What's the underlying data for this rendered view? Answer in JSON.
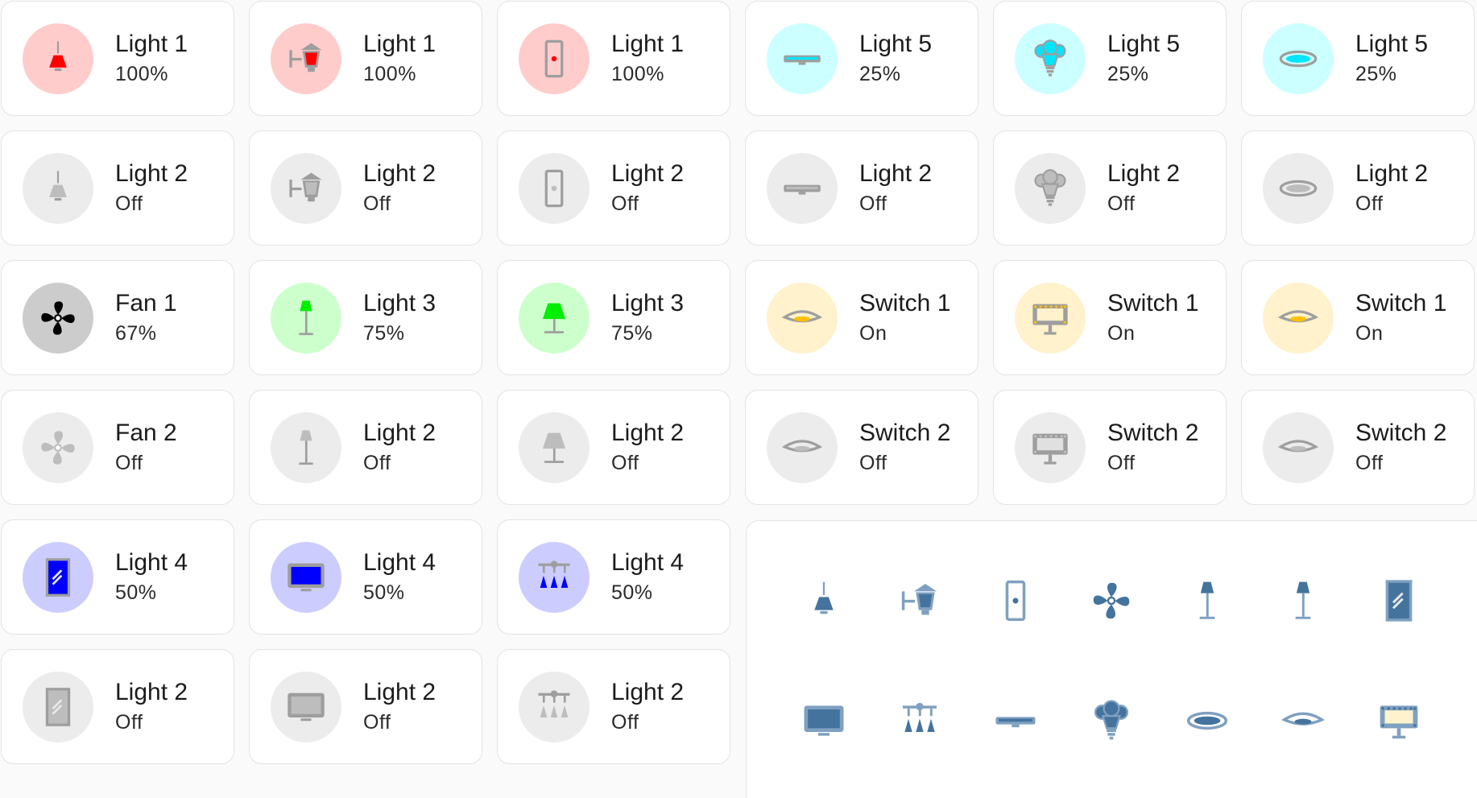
{
  "tiles": [
    {
      "name": "Light 1",
      "state": "100%",
      "icon": "hanging-lamp-icon",
      "bg": "#ffcccc",
      "fg": "#ff0000"
    },
    {
      "name": "Light 1",
      "state": "100%",
      "icon": "wall-lantern-icon",
      "bg": "#ffcccc",
      "fg": "#ff0000"
    },
    {
      "name": "Light 1",
      "state": "100%",
      "icon": "light-switch-icon",
      "bg": "#ffcccc",
      "fg": "#ff0000"
    },
    {
      "name": "Light 5",
      "state": "25%",
      "icon": "strip-light-icon",
      "bg": "#ccffff",
      "fg": "#00e5ff"
    },
    {
      "name": "Light 5",
      "state": "25%",
      "icon": "ceiling-bulbs-icon",
      "bg": "#ccffff",
      "fg": "#00e5ff"
    },
    {
      "name": "Light 5",
      "state": "25%",
      "icon": "ceiling-disc-icon",
      "bg": "#ccffff",
      "fg": "#00e5ff"
    },
    {
      "name": "Light 2",
      "state": "Off",
      "icon": "hanging-lamp-icon",
      "bg": "#ececec",
      "fg": "#bdbdbd"
    },
    {
      "name": "Light 2",
      "state": "Off",
      "icon": "wall-lantern-icon",
      "bg": "#ececec",
      "fg": "#bdbdbd"
    },
    {
      "name": "Light 2",
      "state": "Off",
      "icon": "light-switch-icon",
      "bg": "#ececec",
      "fg": "#bdbdbd"
    },
    {
      "name": "Light 2",
      "state": "Off",
      "icon": "strip-light-icon",
      "bg": "#ececec",
      "fg": "#bdbdbd"
    },
    {
      "name": "Light 2",
      "state": "Off",
      "icon": "ceiling-bulbs-icon",
      "bg": "#ececec",
      "fg": "#bdbdbd"
    },
    {
      "name": "Light 2",
      "state": "Off",
      "icon": "ceiling-disc-icon",
      "bg": "#ececec",
      "fg": "#bdbdbd"
    },
    {
      "name": "Fan 1",
      "state": "67%",
      "icon": "fan-icon",
      "bg": "#cccccc",
      "fg": "#000000"
    },
    {
      "name": "Light 3",
      "state": "75%",
      "icon": "floor-lamp-icon",
      "bg": "#ccffcc",
      "fg": "#00ee00"
    },
    {
      "name": "Light 3",
      "state": "75%",
      "icon": "table-lamp-icon",
      "bg": "#ccffcc",
      "fg": "#00ee00"
    },
    {
      "name": "Switch 1",
      "state": "On",
      "icon": "flush-light-icon",
      "bg": "#fff2cc",
      "fg": "#ffbf00"
    },
    {
      "name": "Switch 1",
      "state": "On",
      "icon": "vanity-mirror-icon",
      "bg": "#fff2cc",
      "fg": "#ffbf00"
    },
    {
      "name": "Switch 1",
      "state": "On",
      "icon": "flush-light-icon",
      "bg": "#fff2cc",
      "fg": "#ffbf00"
    },
    {
      "name": "Fan 2",
      "state": "Off",
      "icon": "fan-icon",
      "bg": "#ececec",
      "fg": "#bdbdbd"
    },
    {
      "name": "Light 2",
      "state": "Off",
      "icon": "floor-lamp-icon",
      "bg": "#ececec",
      "fg": "#bdbdbd"
    },
    {
      "name": "Light 2",
      "state": "Off",
      "icon": "table-lamp-icon",
      "bg": "#ececec",
      "fg": "#bdbdbd"
    },
    {
      "name": "Switch 2",
      "state": "Off",
      "icon": "flush-light-icon",
      "bg": "#ececec",
      "fg": "#bdbdbd"
    },
    {
      "name": "Switch 2",
      "state": "Off",
      "icon": "vanity-mirror-icon",
      "bg": "#ececec",
      "fg": "#bdbdbd"
    },
    {
      "name": "Switch 2",
      "state": "Off",
      "icon": "flush-light-icon",
      "bg": "#ececec",
      "fg": "#bdbdbd"
    },
    {
      "name": "Light 4",
      "state": "50%",
      "icon": "mirror-icon",
      "bg": "#ccccff",
      "fg": "#0000ff"
    },
    {
      "name": "Light 4",
      "state": "50%",
      "icon": "monitor-icon",
      "bg": "#ccccff",
      "fg": "#0000ff"
    },
    {
      "name": "Light 4",
      "state": "50%",
      "icon": "chandelier-icon",
      "bg": "#ccccff",
      "fg": "#0000ff"
    },
    {
      "name": "Light 2",
      "state": "Off",
      "icon": "mirror-icon",
      "bg": "#ececec",
      "fg": "#bdbdbd"
    },
    {
      "name": "Light 2",
      "state": "Off",
      "icon": "monitor-icon",
      "bg": "#ececec",
      "fg": "#bdbdbd"
    },
    {
      "name": "Light 2",
      "state": "Off",
      "icon": "chandelier-icon",
      "bg": "#ececec",
      "fg": "#bdbdbd"
    }
  ],
  "icon_panel": {
    "color": "#44739e",
    "icons": [
      "hanging-lamp-icon",
      "wall-lantern-icon",
      "light-switch-icon",
      "fan-icon",
      "floor-lamp-icon",
      "floor-lamp-icon",
      "mirror-icon",
      "monitor-icon",
      "chandelier-icon",
      "strip-light-icon",
      "ceiling-bulbs-icon",
      "ceiling-disc-icon",
      "flush-light-icon",
      "vanity-mirror-icon"
    ]
  }
}
